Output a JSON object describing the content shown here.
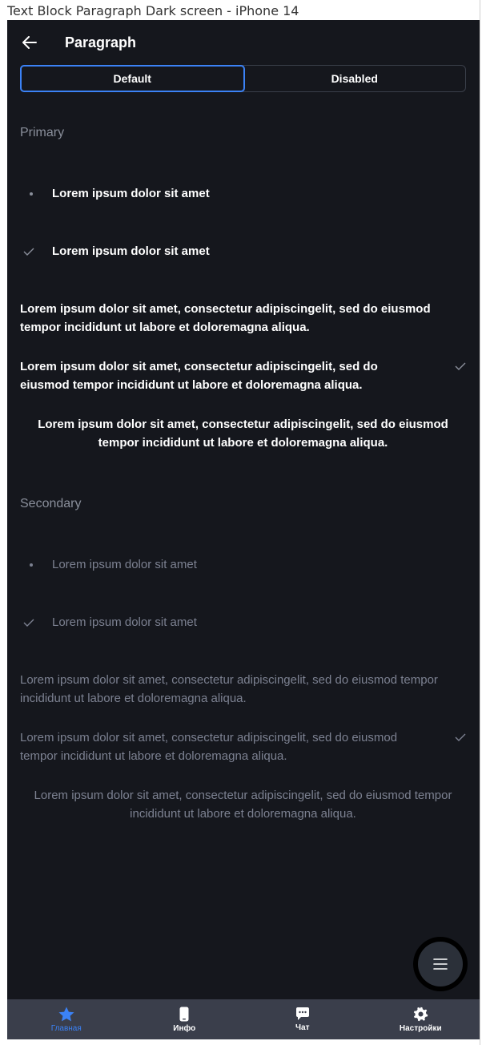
{
  "frame": {
    "title": "Text Block Paragraph Dark screen - iPhone 14"
  },
  "header": {
    "title": "Paragraph",
    "back_icon": "arrow-left-icon"
  },
  "tabs": [
    {
      "label": "Default",
      "active": true
    },
    {
      "label": "Disabled",
      "active": false
    }
  ],
  "primary": {
    "label": "Primary",
    "bullet_text": "Lorem ipsum dolor sit amet",
    "check_text": "Lorem ipsum dolor sit amet",
    "paragraph": "Lorem ipsum dolor sit amet, consectetur adipiscingelit, sed do eiusmod tempor incididunt ut labore et doloremagna aliqua.",
    "paragraph_check": "Lorem ipsum dolor sit amet, consectetur adipiscingelit, sed do eiusmod tempor incididunt ut labore et doloremagna aliqua.",
    "paragraph_center": "Lorem ipsum dolor sit amet, consectetur adipiscingelit, sed do eiusmod tempor incididunt ut labore et doloremagna aliqua."
  },
  "secondary": {
    "label": "Secondary",
    "bullet_text": "Lorem ipsum dolor sit amet",
    "check_text": "Lorem ipsum dolor sit amet",
    "paragraph": "Lorem ipsum dolor sit amet, consectetur adipiscingelit, sed do eiusmod tempor incididunt ut labore et doloremagna aliqua.",
    "paragraph_check": "Lorem ipsum dolor sit amet, consectetur adipiscingelit, sed do eiusmod tempor incididunt ut labore et doloremagna aliqua.",
    "paragraph_center": "Lorem ipsum dolor sit amet, consectetur adipiscingelit, sed do eiusmod tempor incididunt ut labore et doloremagna aliqua."
  },
  "fab": {
    "icon": "menu-icon"
  },
  "tabbar": [
    {
      "label": "Главная",
      "icon": "star-icon",
      "active": true
    },
    {
      "label": "Инфо",
      "icon": "phone-icon",
      "active": false
    },
    {
      "label": "Чат",
      "icon": "chat-icon",
      "active": false
    },
    {
      "label": "Настройки",
      "icon": "gear-icon",
      "active": false
    }
  ],
  "colors": {
    "background": "#15171d",
    "accent": "#3b82f6",
    "primary_text": "#ffffff",
    "secondary_text": "#7c8191",
    "tabbar": "#3a3e4b"
  }
}
